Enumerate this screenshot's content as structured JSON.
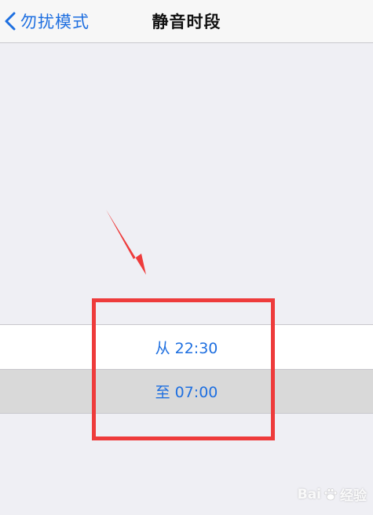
{
  "nav": {
    "back_label": "勿扰模式",
    "title": "静音时段"
  },
  "schedule": {
    "from_label": "从 22:30",
    "to_label": "至 07:00"
  },
  "watermark": {
    "text_left": "Bai",
    "text_right": "经验"
  },
  "colors": {
    "accent": "#1e6fe0",
    "annotation": "#ee3b3b",
    "background": "#efeff4"
  }
}
